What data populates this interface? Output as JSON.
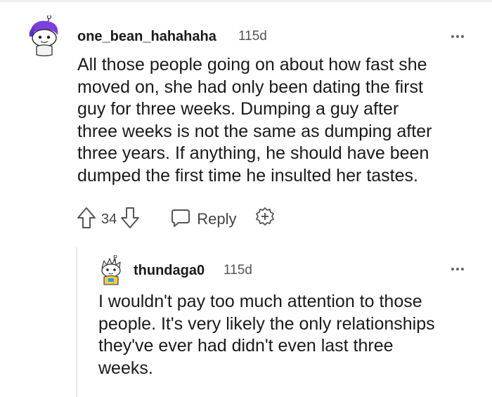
{
  "comment1": {
    "username": "one_bean_hahahaha",
    "timestamp": "115d",
    "lines": [
      "All those people going on about how fast she",
      "moved on, she had only been dating the first",
      "guy for three weeks. Dumping a guy after",
      "three weeks is not the same as dumping after",
      "three years. If anything, he should have been",
      "dumped the first time he insulted her tastes."
    ],
    "votes": "34",
    "reply_label": "Reply"
  },
  "comment2": {
    "username": "thundaga0",
    "timestamp": "115d",
    "lines": [
      "I wouldn't pay too much attention to those",
      "people. It's very likely the only relationships",
      "they've ever had didn't even last three",
      "weeks."
    ]
  },
  "icons": {
    "upvote": "upvote-icon",
    "downvote": "downvote-icon",
    "reply": "reply-bubble-icon",
    "award": "award-plus-icon",
    "more": "more-options-icon"
  },
  "colors": {
    "text": "#1a1a1b",
    "muted": "#555555",
    "avatar1_hair": "#7b3fe0",
    "avatar2_accent": "#f2c94c"
  }
}
